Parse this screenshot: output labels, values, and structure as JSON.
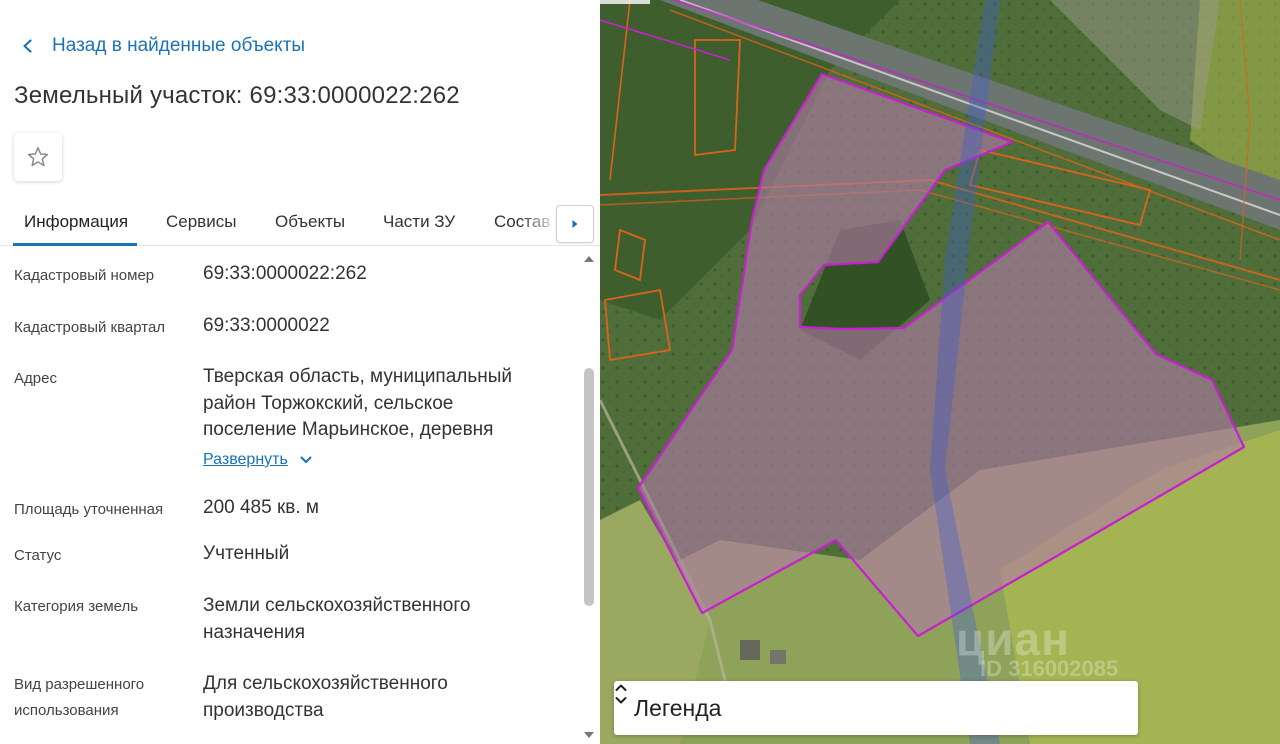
{
  "back_link": {
    "label": "Назад в найденные объекты"
  },
  "page_title": "Земельный участок: 69:33:0000022:262",
  "tabs": [
    {
      "label": "Информация",
      "active": true
    },
    {
      "label": "Сервисы"
    },
    {
      "label": "Объекты"
    },
    {
      "label": "Части ЗУ"
    },
    {
      "label": "Состав"
    }
  ],
  "info_rows": [
    {
      "label": "Кадастровый номер",
      "value": "69:33:0000022:262"
    },
    {
      "label": "Кадастровый квартал",
      "value": "69:33:0000022"
    },
    {
      "label": "Адрес",
      "value": "Тверская область, муниципальный район Торжокский, сельское поселение Марьинское, деревня"
    },
    {
      "label": "Площадь уточненная",
      "value": "200 485 кв. м"
    },
    {
      "label": "Статус",
      "value": "Учтенный"
    },
    {
      "label": "Категория земель",
      "value": "Земли сельскохозяйственного назначения"
    },
    {
      "label": "Вид разрешенного использования",
      "value": "Для сельскохозяйственного производства"
    }
  ],
  "expand_label": "Развернуть",
  "map": {
    "watermark": "циан",
    "watermark_id": "ID 316002085",
    "legend_label": "Легенда"
  },
  "colors": {
    "accent": "#1a73b8",
    "parcel_outline": "#c81fd0",
    "parcel_fill": "#b07aa6",
    "cadastral_lines": "#d9641c",
    "zone_fill": "#b7c24e"
  },
  "icons": [
    "chevron-left-icon",
    "star-icon",
    "caret-right-icon",
    "chevron-down-icon",
    "sort-arrows-icon"
  ]
}
